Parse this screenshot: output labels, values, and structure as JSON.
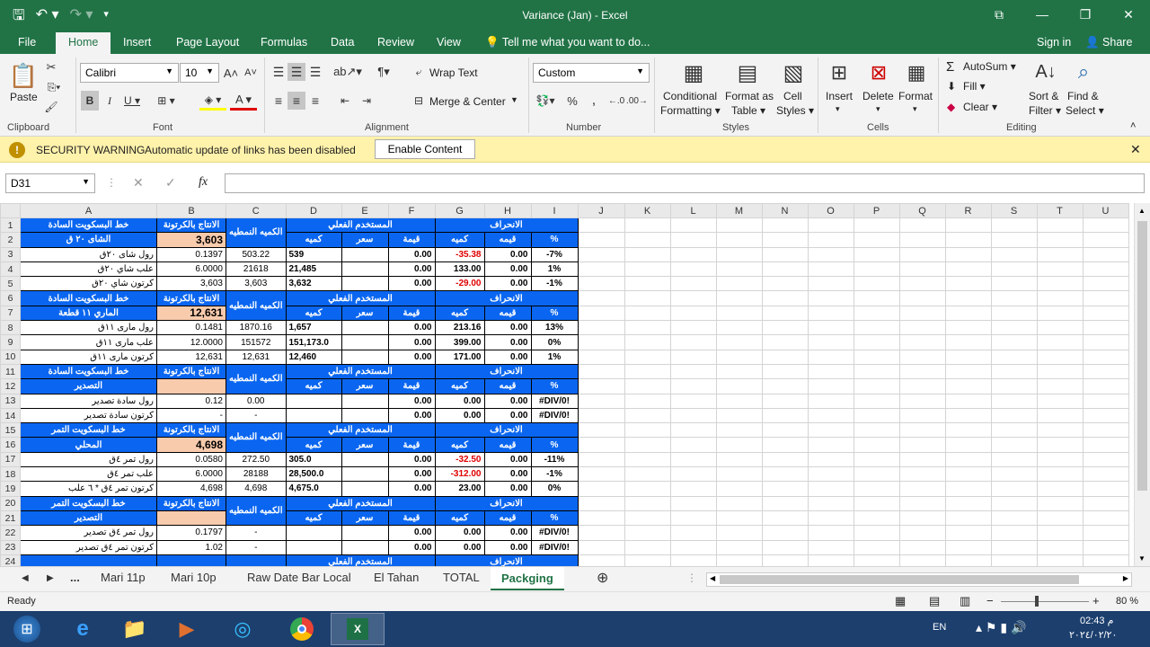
{
  "window": {
    "title": "Variance (Jan)  -  Excel",
    "buttons": [
      "⧉",
      "—",
      "❐",
      "✕"
    ]
  },
  "menu_tabs": [
    "File",
    "Home",
    "Insert",
    "Page Layout",
    "Formulas",
    "Data",
    "Review",
    "View"
  ],
  "tell_me": "Tell me what you want to do...",
  "account": {
    "sign_in": "Sign in",
    "share": "Share"
  },
  "ribbon": {
    "paste": "Paste",
    "font_name": "Calibri",
    "font_size": "10",
    "wrap_text": "Wrap Text",
    "merge_center": "Merge & Center",
    "number_format": "Custom",
    "conditional": [
      "Conditional",
      "Formatting"
    ],
    "format_as": [
      "Format as",
      "Table"
    ],
    "cell_styles": [
      "Cell",
      "Styles"
    ],
    "insert": "Insert",
    "delete": "Delete",
    "format": "Format",
    "autosum": "AutoSum",
    "fill": "Fill",
    "clear": "Clear",
    "sort_filter": [
      "Sort &",
      "Filter"
    ],
    "find_select": [
      "Find &",
      "Select"
    ],
    "groups": [
      "Clipboard",
      "Font",
      "Alignment",
      "Number",
      "Styles",
      "Cells",
      "Editing"
    ]
  },
  "security": {
    "label": "SECURITY WARNING",
    "message": "Automatic update of links has been disabled",
    "button": "Enable Content"
  },
  "formula_bar": {
    "name_box": "D31",
    "fx": "fx",
    "content": ""
  },
  "columns": [
    "A",
    "B",
    "C",
    "D",
    "E",
    "F",
    "G",
    "H",
    "I",
    "J",
    "K",
    "L",
    "M",
    "N",
    "O",
    "P",
    "Q",
    "R",
    "S",
    "T",
    "U"
  ],
  "headers": {
    "prod_carton": "الانتاج بالكرتونة",
    "std_qty": "الكميه النمطيه",
    "actual_used": "المستخدم الفعلي",
    "deviation": "الانحراف",
    "qty": "كميه",
    "price": "سعر",
    "value": "قيمة",
    "value2": "قيمه",
    "pct": "%"
  },
  "blocks": [
    {
      "title": [
        "خط البسكويت السادة",
        "الشاى ٢٠ ق"
      ],
      "production": "3,603",
      "rows": [
        [
          "رول شاى ٢٠ق",
          "0.1397",
          "503.22",
          "539",
          "",
          "0.00",
          "-35.38",
          "0.00",
          "-7%"
        ],
        [
          "علب شاي ٢٠ق",
          "6.0000",
          "21618",
          "21,485",
          "",
          "0.00",
          "133.00",
          "0.00",
          "1%"
        ],
        [
          "كرتون شاي ٢٠ق",
          "3,603",
          "3,603",
          "3,632",
          "",
          "0.00",
          "-29.00",
          "0.00",
          "-1%"
        ]
      ]
    },
    {
      "title": [
        "خط البسكويت السادة",
        "الماري ١١ قطعة"
      ],
      "production": "12,631",
      "rows": [
        [
          "رول مارى ١١ق",
          "0.1481",
          "1870.16",
          "1,657",
          "",
          "0.00",
          "213.16",
          "0.00",
          "13%"
        ],
        [
          "علب مارى ١١ق",
          "12.0000",
          "151572",
          "151,173.0",
          "",
          "0.00",
          "399.00",
          "0.00",
          "0%"
        ],
        [
          "كرتون مارى ١١ق",
          "12,631",
          "12,631",
          "12,460",
          "",
          "0.00",
          "171.00",
          "0.00",
          "1%"
        ]
      ]
    },
    {
      "title": [
        "خط البسكويت السادة",
        "التصدير"
      ],
      "production": "",
      "rows": [
        [
          "رول سادة تصدير",
          "0.12",
          "0.00",
          "",
          "",
          "0.00",
          "0.00",
          "0.00",
          "#DIV/0!"
        ],
        [
          "كرتون سادة تصدير",
          "-",
          "-",
          "",
          "",
          "0.00",
          "0.00",
          "0.00",
          "#DIV/0!"
        ]
      ]
    },
    {
      "title": [
        "خط البسكويت التمر",
        "المحلي"
      ],
      "production": "4,698",
      "rows": [
        [
          "رول تمر ٤ق",
          "0.0580",
          "272.50",
          "305.0",
          "",
          "0.00",
          "-32.50",
          "0.00",
          "-11%"
        ],
        [
          "علب تمر ٤ق",
          "6.0000",
          "28188",
          "28,500.0",
          "",
          "0.00",
          "-312.00",
          "0.00",
          "-1%"
        ],
        [
          "كرتون تمر ٤ق * ٦ علب",
          "4,698",
          "4,698",
          "4,675.0",
          "",
          "0.00",
          "23.00",
          "0.00",
          "0%"
        ]
      ]
    },
    {
      "title": [
        "خط البسكويت التمر",
        "التصدير"
      ],
      "production": "",
      "rows": [
        [
          "رول تمر ٤ق تصدير",
          "0.1797",
          "-",
          "",
          "",
          "0.00",
          "0.00",
          "0.00",
          "#DIV/0!"
        ],
        [
          "كرتون تمر ٤ق تصدير",
          "1.02",
          "-",
          "",
          "",
          "0.00",
          "0.00",
          "0.00",
          "#DIV/0!"
        ]
      ]
    }
  ],
  "sheet_tabs": [
    "...",
    "Mari 11p",
    "Mari 10p",
    "Raw Date Bar Local",
    "El Tahan",
    "TOTAL",
    "Packging"
  ],
  "active_sheet": "Packging",
  "status": {
    "ready": "Ready",
    "zoom": "80 %"
  },
  "taskbar": {
    "lang": "EN",
    "time": "02:43 م",
    "date": "٢٠٢٤/٠٢/٢٠"
  }
}
